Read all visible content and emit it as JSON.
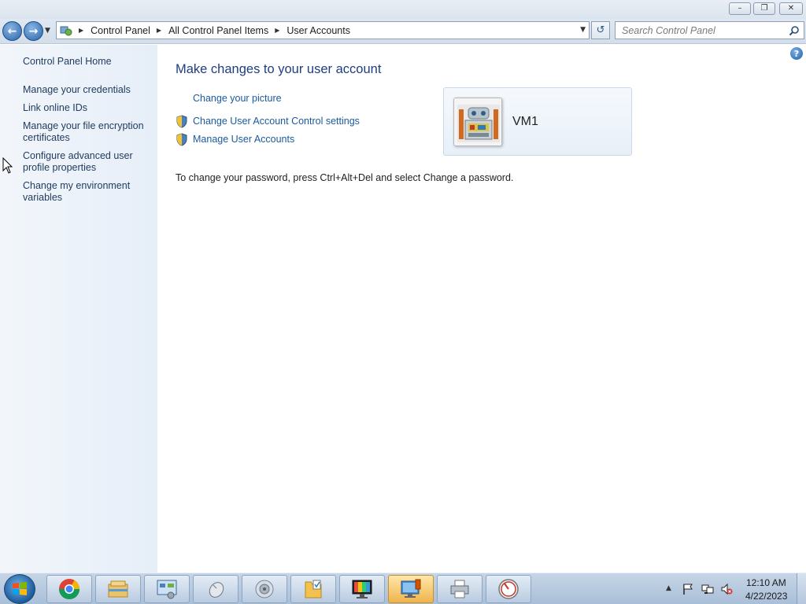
{
  "window": {
    "minimize_label": "–",
    "maximize_label": "❐",
    "close_label": "✕"
  },
  "address_bar": {
    "breadcrumbs": [
      "Control Panel",
      "All Control Panel Items",
      "User Accounts"
    ]
  },
  "search": {
    "placeholder": "Search Control Panel"
  },
  "sidebar": {
    "home": "Control Panel Home",
    "links": [
      "Manage your credentials",
      "Link online IDs",
      "Manage your file encryption certificates",
      "Configure advanced user profile properties",
      "Change my environment variables"
    ]
  },
  "main": {
    "title": "Make changes to your user account",
    "tasks": [
      "Change your picture",
      "Change User Account Control settings",
      "Manage User Accounts"
    ],
    "note": "To change your password, press Ctrl+Alt+Del and select Change a password.",
    "user_name": "VM1"
  },
  "taskbar": {
    "apps": [
      "chrome-icon",
      "file-explorer-icon",
      "control-panel-icon",
      "mouse-icon",
      "speaker-icon",
      "folder-icon",
      "display-icon",
      "system-icon",
      "printer-icon",
      "gauge-icon"
    ],
    "clock_time": "12:10 AM",
    "clock_date": "4/22/2023"
  }
}
